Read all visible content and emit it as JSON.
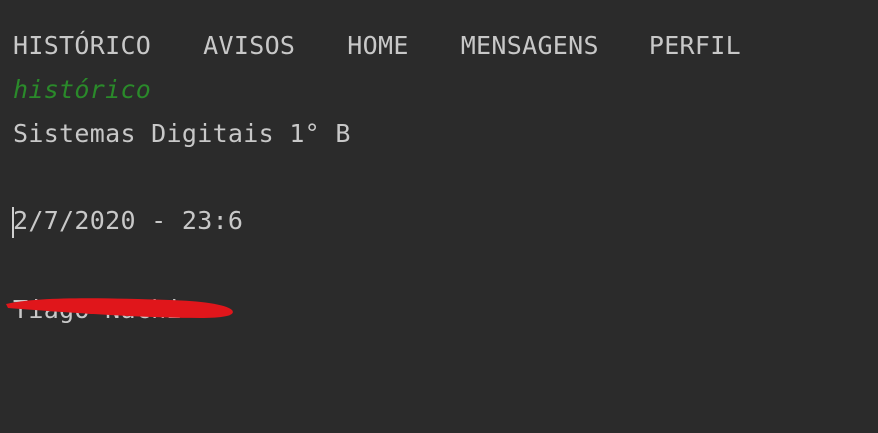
{
  "nav": {
    "items": [
      "HISTÓRICO",
      "AVISOS",
      "HOME",
      "MENSAGENS",
      "PERFIL"
    ]
  },
  "section_title": "histórico",
  "entry": {
    "subject": "Sistemas Digitais 1° B",
    "datetime": "2/7/2020 - 23:6",
    "author": "Tiago Nachi"
  },
  "colors": {
    "background": "#2b2b2b",
    "text": "#c8c8c8",
    "heading": "#2a8a2a",
    "redaction": "#e0161b"
  }
}
